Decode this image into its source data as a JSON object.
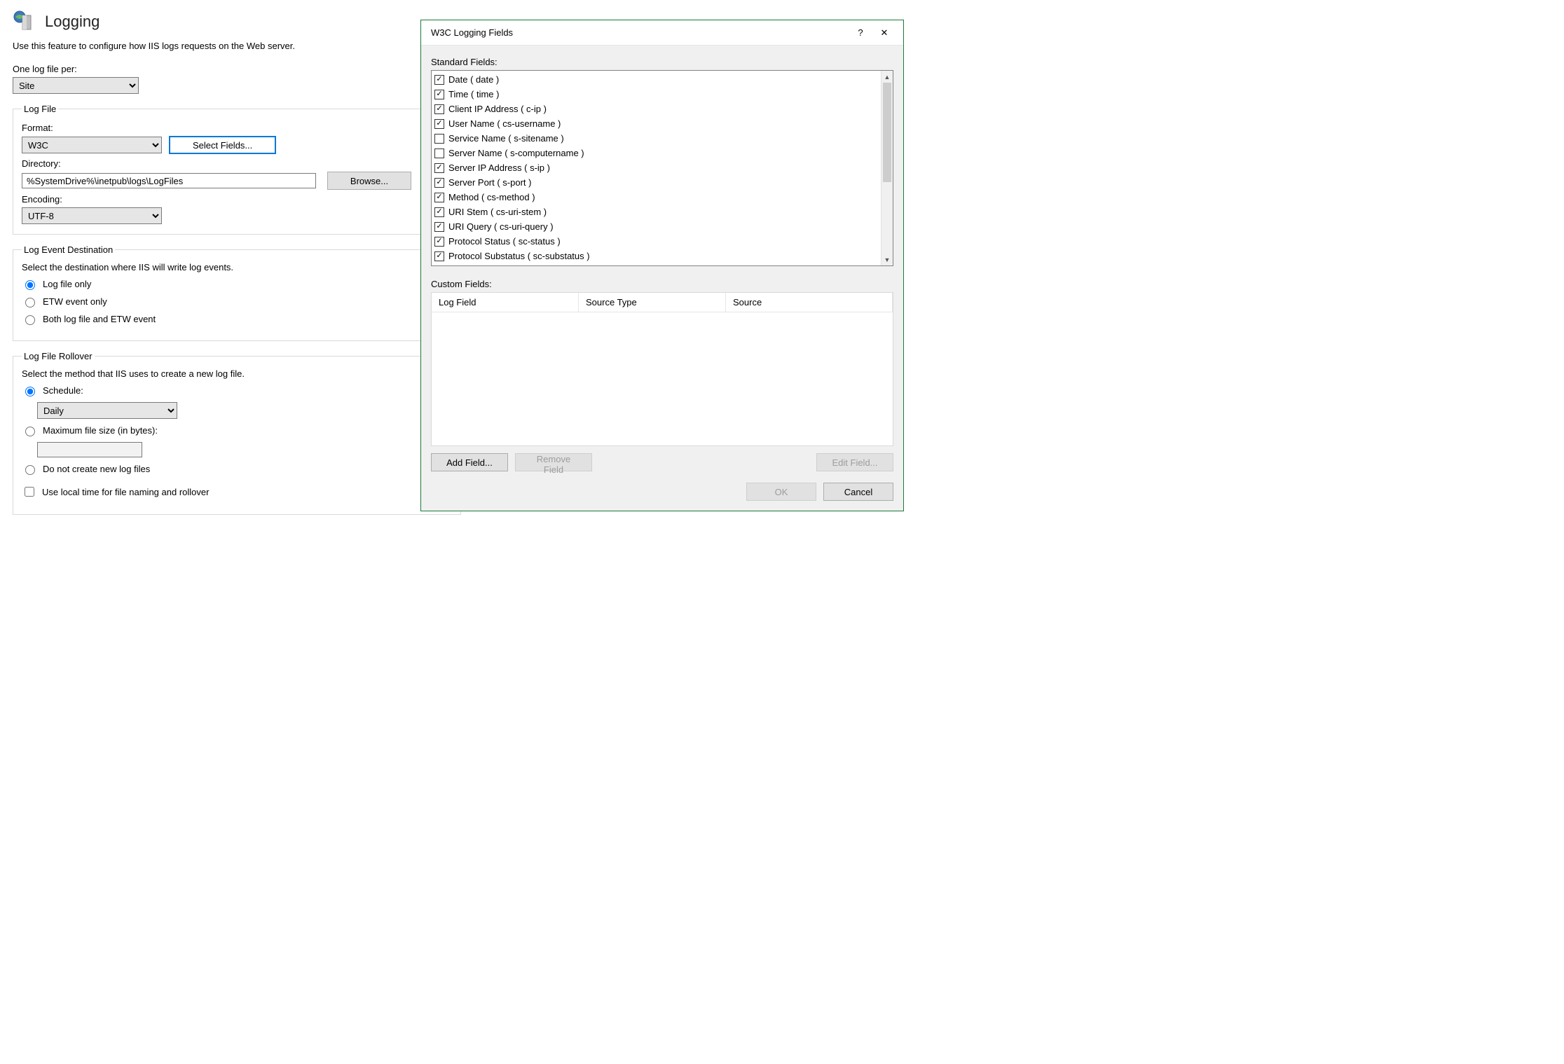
{
  "page": {
    "title": "Logging",
    "intro": "Use this feature to configure how IIS logs requests on the Web server.",
    "one_log_file_per_label": "One log file per:",
    "one_log_file_per_value": "Site"
  },
  "log_file": {
    "legend": "Log File",
    "format_label": "Format:",
    "format_value": "W3C",
    "select_fields_btn": "Select Fields...",
    "directory_label": "Directory:",
    "directory_value": "%SystemDrive%\\inetpub\\logs\\LogFiles",
    "browse_btn": "Browse...",
    "encoding_label": "Encoding:",
    "encoding_value": "UTF-8"
  },
  "log_event_dest": {
    "legend": "Log Event Destination",
    "desc": "Select the destination where IIS will write log events.",
    "options": {
      "log_file_only": "Log file only",
      "etw_only": "ETW event only",
      "both": "Both log file and ETW event"
    },
    "selected": "log_file_only"
  },
  "rollover": {
    "legend": "Log File Rollover",
    "desc": "Select the method that IIS uses to create a new log file.",
    "schedule_label": "Schedule:",
    "schedule_value": "Daily",
    "max_size_label": "Maximum file size (in bytes):",
    "max_size_value": "",
    "no_new_label": "Do not create new log files",
    "use_local_time_label": "Use local time for file naming and rollover",
    "selected": "schedule"
  },
  "dialog": {
    "title": "W3C Logging Fields",
    "help_char": "?",
    "close_char": "✕",
    "standard_fields_label": "Standard Fields:",
    "standard_fields": [
      {
        "label": "Date ( date )",
        "checked": true
      },
      {
        "label": "Time ( time )",
        "checked": true
      },
      {
        "label": "Client IP Address ( c-ip )",
        "checked": true
      },
      {
        "label": "User Name ( cs-username )",
        "checked": true
      },
      {
        "label": "Service Name ( s-sitename )",
        "checked": false
      },
      {
        "label": "Server Name ( s-computername )",
        "checked": false
      },
      {
        "label": "Server IP Address ( s-ip )",
        "checked": true
      },
      {
        "label": "Server Port ( s-port )",
        "checked": true
      },
      {
        "label": "Method ( cs-method )",
        "checked": true
      },
      {
        "label": "URI Stem ( cs-uri-stem )",
        "checked": true
      },
      {
        "label": "URI Query ( cs-uri-query )",
        "checked": true
      },
      {
        "label": "Protocol Status ( sc-status )",
        "checked": true
      },
      {
        "label": "Protocol Substatus ( sc-substatus )",
        "checked": true
      }
    ],
    "custom_fields_label": "Custom Fields:",
    "custom_cols": {
      "logfield": "Log Field",
      "srctype": "Source Type",
      "src": "Source"
    },
    "add_field_btn": "Add Field...",
    "remove_field_btn": "Remove Field",
    "edit_field_btn": "Edit Field...",
    "ok_btn": "OK",
    "cancel_btn": "Cancel"
  }
}
